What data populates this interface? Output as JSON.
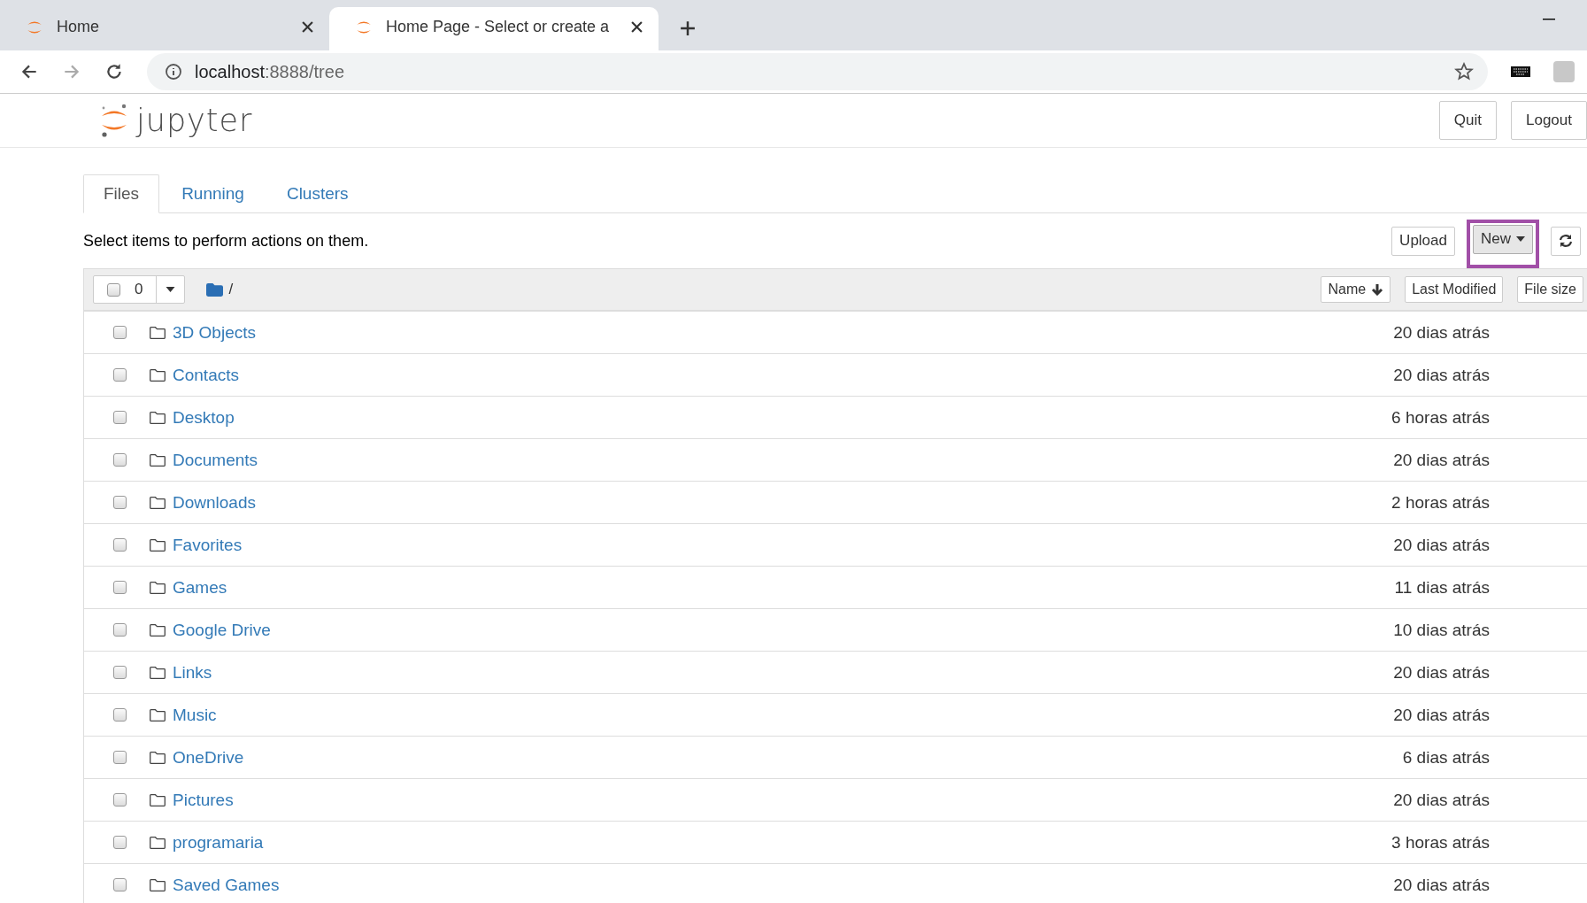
{
  "browser": {
    "tabs": [
      {
        "title": "Home",
        "selected": false
      },
      {
        "title": "Home Page - Select or create a",
        "selected": true
      }
    ],
    "url": {
      "host": "localhost",
      "path": ":8888/tree"
    }
  },
  "header": {
    "logo_text": "jupyter",
    "buttons": [
      "Quit",
      "Logout"
    ]
  },
  "nav_tabs": [
    {
      "label": "Files",
      "selected": true
    },
    {
      "label": "Running",
      "selected": false
    },
    {
      "label": "Clusters",
      "selected": false
    }
  ],
  "instruction": "Select items to perform actions on them.",
  "toolbar_buttons": [
    {
      "kind": "button",
      "label": "Upload"
    },
    {
      "kind": "dropdown",
      "label": "New",
      "highlighted": true
    },
    {
      "kind": "refresh"
    }
  ],
  "list_header": {
    "all_checked": false,
    "selected_count": "0",
    "path": "/",
    "sort_buttons": [
      {
        "label": "Name",
        "sorted": true
      },
      {
        "label": "Last Modified",
        "sorted": false
      },
      {
        "label": "File size",
        "sorted": false
      }
    ]
  },
  "items": [
    {
      "name": "3D Objects",
      "modified": "20 dias atrás",
      "checked": false
    },
    {
      "name": "Contacts",
      "modified": "20 dias atrás",
      "checked": false
    },
    {
      "name": "Desktop",
      "modified": "6 horas atrás",
      "checked": false
    },
    {
      "name": "Documents",
      "modified": "20 dias atrás",
      "checked": false
    },
    {
      "name": "Downloads",
      "modified": "2 horas atrás",
      "checked": false
    },
    {
      "name": "Favorites",
      "modified": "20 dias atrás",
      "checked": false
    },
    {
      "name": "Games",
      "modified": "11 dias atrás",
      "checked": false
    },
    {
      "name": "Google Drive",
      "modified": "10 dias atrás",
      "checked": false
    },
    {
      "name": "Links",
      "modified": "20 dias atrás",
      "checked": false
    },
    {
      "name": "Music",
      "modified": "20 dias atrás",
      "checked": false
    },
    {
      "name": "OneDrive",
      "modified": "6 dias atrás",
      "checked": false
    },
    {
      "name": "Pictures",
      "modified": "20 dias atrás",
      "checked": false
    },
    {
      "name": "programaria",
      "modified": "3 horas atrás",
      "checked": false
    },
    {
      "name": "Saved Games",
      "modified": "20 dias atrás",
      "checked": false
    }
  ]
}
